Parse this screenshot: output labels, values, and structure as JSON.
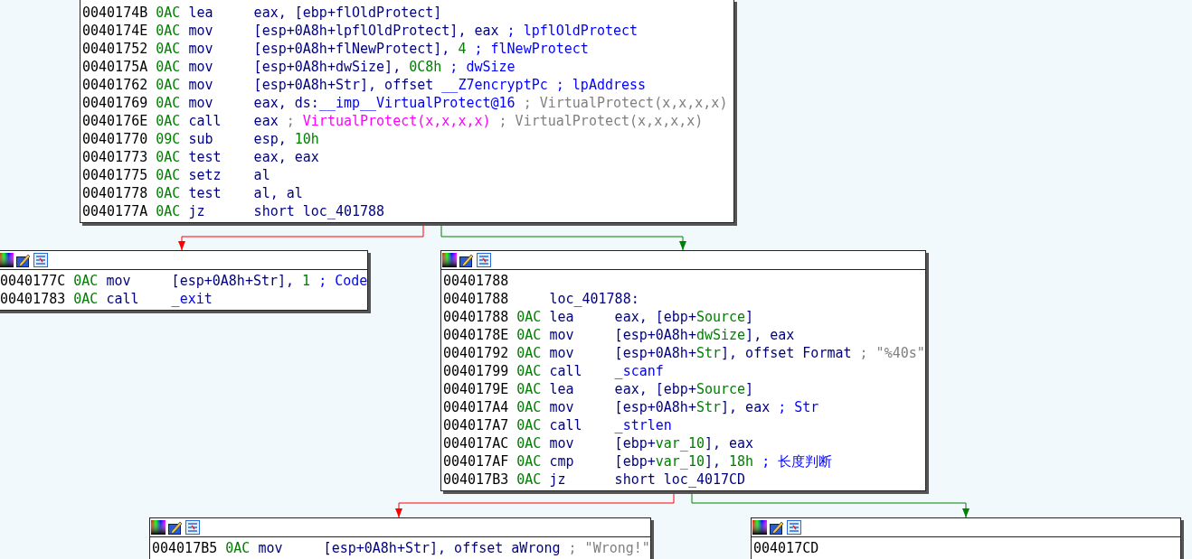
{
  "blocks": [
    {
      "toolbar": false,
      "lines": [
        {
          "kind": "instr",
          "address": "0040174B",
          "sp": "0AC",
          "mnemonic": "lea",
          "operands": [
            {
              "t": "eax, [ebp+flOldProtect]",
              "kind": "plain"
            }
          ]
        },
        {
          "kind": "instr",
          "address": "0040174E",
          "sp": "0AC",
          "mnemonic": "mov",
          "operands": [
            {
              "t": "[esp+0A8h+lpflOldProtect], eax",
              "kind": "plain"
            },
            {
              "t": " ; lpflOldProtect",
              "kind": "cmt"
            }
          ]
        },
        {
          "kind": "instr",
          "address": "00401752",
          "sp": "0AC",
          "mnemonic": "mov",
          "operands": [
            {
              "t": "[esp+0A8h+flNewProtect], ",
              "kind": "plain"
            },
            {
              "t": "4",
              "kind": "num"
            },
            {
              "t": " ; flNewProtect",
              "kind": "cmt"
            }
          ]
        },
        {
          "kind": "instr",
          "address": "0040175A",
          "sp": "0AC",
          "mnemonic": "mov",
          "operands": [
            {
              "t": "[esp+0A8h+dwSize], ",
              "kind": "plain"
            },
            {
              "t": "0C8h",
              "kind": "num"
            },
            {
              "t": " ; dwSize",
              "kind": "cmt"
            }
          ]
        },
        {
          "kind": "instr",
          "address": "00401762",
          "sp": "0AC",
          "mnemonic": "mov",
          "operands": [
            {
              "t": "[esp+0A8h+Str], offset ",
              "kind": "plain"
            },
            {
              "t": "__Z7encryptPc",
              "kind": "name"
            },
            {
              "t": " ; lpAddress",
              "kind": "cmt"
            }
          ]
        },
        {
          "kind": "instr",
          "address": "00401769",
          "sp": "0AC",
          "mnemonic": "mov",
          "operands": [
            {
              "t": "eax, ds:",
              "kind": "plain"
            },
            {
              "t": "__imp__VirtualProtect@16",
              "kind": "name"
            },
            {
              "t": " ; VirtualProtect(x,x,x,x)",
              "kind": "gray"
            }
          ]
        },
        {
          "kind": "instr",
          "address": "0040176E",
          "sp": "0AC",
          "mnemonic": "call",
          "operands": [
            {
              "t": "eax",
              "kind": "plain"
            },
            {
              "t": " ; ",
              "kind": "gray"
            },
            {
              "t": "VirtualProtect(x,x,x,x)",
              "kind": "func"
            },
            {
              "t": " ; VirtualProtect(x,x,x,x)",
              "kind": "gray"
            }
          ]
        },
        {
          "kind": "instr",
          "address": "00401770",
          "sp": "09C",
          "mnemonic": "sub",
          "operands": [
            {
              "t": "esp, ",
              "kind": "plain"
            },
            {
              "t": "10h",
              "kind": "num"
            }
          ]
        },
        {
          "kind": "instr",
          "address": "00401773",
          "sp": "0AC",
          "mnemonic": "test",
          "operands": [
            {
              "t": "eax, eax",
              "kind": "plain"
            }
          ]
        },
        {
          "kind": "instr",
          "address": "00401775",
          "sp": "0AC",
          "mnemonic": "setz",
          "operands": [
            {
              "t": "al",
              "kind": "plain"
            }
          ]
        },
        {
          "kind": "instr",
          "address": "00401778",
          "sp": "0AC",
          "mnemonic": "test",
          "operands": [
            {
              "t": "al, al",
              "kind": "plain"
            }
          ]
        },
        {
          "kind": "instr",
          "address": "0040177A",
          "sp": "0AC",
          "mnemonic": "jz",
          "operands": [
            {
              "t": "short loc_401788",
              "kind": "plain"
            }
          ]
        }
      ]
    },
    {
      "toolbar": true,
      "lines": [
        {
          "kind": "instr",
          "address": "0040177C",
          "sp": "0AC",
          "mnemonic": "mov",
          "operands": [
            {
              "t": "[esp+0A8h+Str], ",
              "kind": "plain"
            },
            {
              "t": "1",
              "kind": "num"
            },
            {
              "t": " ; Code",
              "kind": "cmt"
            }
          ]
        },
        {
          "kind": "instr",
          "address": "00401783",
          "sp": "0AC",
          "mnemonic": "call",
          "operands": [
            {
              "t": "_exit",
              "kind": "name"
            }
          ]
        }
      ]
    },
    {
      "toolbar": true,
      "lines": [
        {
          "kind": "address",
          "address": "00401788"
        },
        {
          "kind": "label",
          "address": "00401788",
          "label": "loc_401788:"
        },
        {
          "kind": "instr",
          "address": "00401788",
          "sp": "0AC",
          "mnemonic": "lea",
          "operands": [
            {
              "t": "eax, [ebp+",
              "kind": "plain"
            },
            {
              "t": "Source",
              "kind": "num"
            },
            {
              "t": "]",
              "kind": "plain"
            }
          ]
        },
        {
          "kind": "instr",
          "address": "0040178E",
          "sp": "0AC",
          "mnemonic": "mov",
          "operands": [
            {
              "t": "[esp+0A8h+",
              "kind": "plain"
            },
            {
              "t": "dwSize",
              "kind": "num"
            },
            {
              "t": "], eax",
              "kind": "plain"
            }
          ]
        },
        {
          "kind": "instr",
          "address": "00401792",
          "sp": "0AC",
          "mnemonic": "mov",
          "operands": [
            {
              "t": "[esp+0A8h+",
              "kind": "plain"
            },
            {
              "t": "Str",
              "kind": "num"
            },
            {
              "t": "], offset Format",
              "kind": "plain"
            },
            {
              "t": " ; \"%40s\"",
              "kind": "gray"
            }
          ]
        },
        {
          "kind": "instr",
          "address": "00401799",
          "sp": "0AC",
          "mnemonic": "call",
          "operands": [
            {
              "t": "_scanf",
              "kind": "name"
            }
          ]
        },
        {
          "kind": "instr",
          "address": "0040179E",
          "sp": "0AC",
          "mnemonic": "lea",
          "operands": [
            {
              "t": "eax, [ebp+",
              "kind": "plain"
            },
            {
              "t": "Source",
              "kind": "num"
            },
            {
              "t": "]",
              "kind": "plain"
            }
          ]
        },
        {
          "kind": "instr",
          "address": "004017A4",
          "sp": "0AC",
          "mnemonic": "mov",
          "operands": [
            {
              "t": "[esp+0A8h+",
              "kind": "plain"
            },
            {
              "t": "Str",
              "kind": "num"
            },
            {
              "t": "], eax",
              "kind": "plain"
            },
            {
              "t": " ; Str",
              "kind": "cmt"
            }
          ]
        },
        {
          "kind": "instr",
          "address": "004017A7",
          "sp": "0AC",
          "mnemonic": "call",
          "operands": [
            {
              "t": "_strlen",
              "kind": "name"
            }
          ]
        },
        {
          "kind": "instr",
          "address": "004017AC",
          "sp": "0AC",
          "mnemonic": "mov",
          "operands": [
            {
              "t": "[ebp+",
              "kind": "plain"
            },
            {
              "t": "var_10",
              "kind": "num"
            },
            {
              "t": "], eax",
              "kind": "plain"
            }
          ]
        },
        {
          "kind": "instr",
          "address": "004017AF",
          "sp": "0AC",
          "mnemonic": "cmp",
          "operands": [
            {
              "t": "[ebp+",
              "kind": "plain"
            },
            {
              "t": "var_10",
              "kind": "num"
            },
            {
              "t": "], ",
              "kind": "plain"
            },
            {
              "t": "18h",
              "kind": "num"
            },
            {
              "t": " ; 长度判断",
              "kind": "cmt"
            }
          ]
        },
        {
          "kind": "instr",
          "address": "004017B3",
          "sp": "0AC",
          "mnemonic": "jz",
          "operands": [
            {
              "t": "short loc_4017CD",
              "kind": "plain"
            }
          ]
        }
      ]
    },
    {
      "toolbar": true,
      "lines": [
        {
          "kind": "instr",
          "address": "004017B5",
          "sp": "0AC",
          "mnemonic": "mov",
          "operands": [
            {
              "t": "[esp+0A8h+Str], offset aWrong",
              "kind": "plain"
            },
            {
              "t": " ; \"Wrong!\"",
              "kind": "gray"
            }
          ]
        }
      ]
    },
    {
      "toolbar": true,
      "lines": [
        {
          "kind": "address",
          "address": "004017CD"
        }
      ]
    }
  ],
  "edges": [
    {
      "kind": "false"
    },
    {
      "kind": "true"
    },
    {
      "kind": "false"
    },
    {
      "kind": "true"
    }
  ]
}
